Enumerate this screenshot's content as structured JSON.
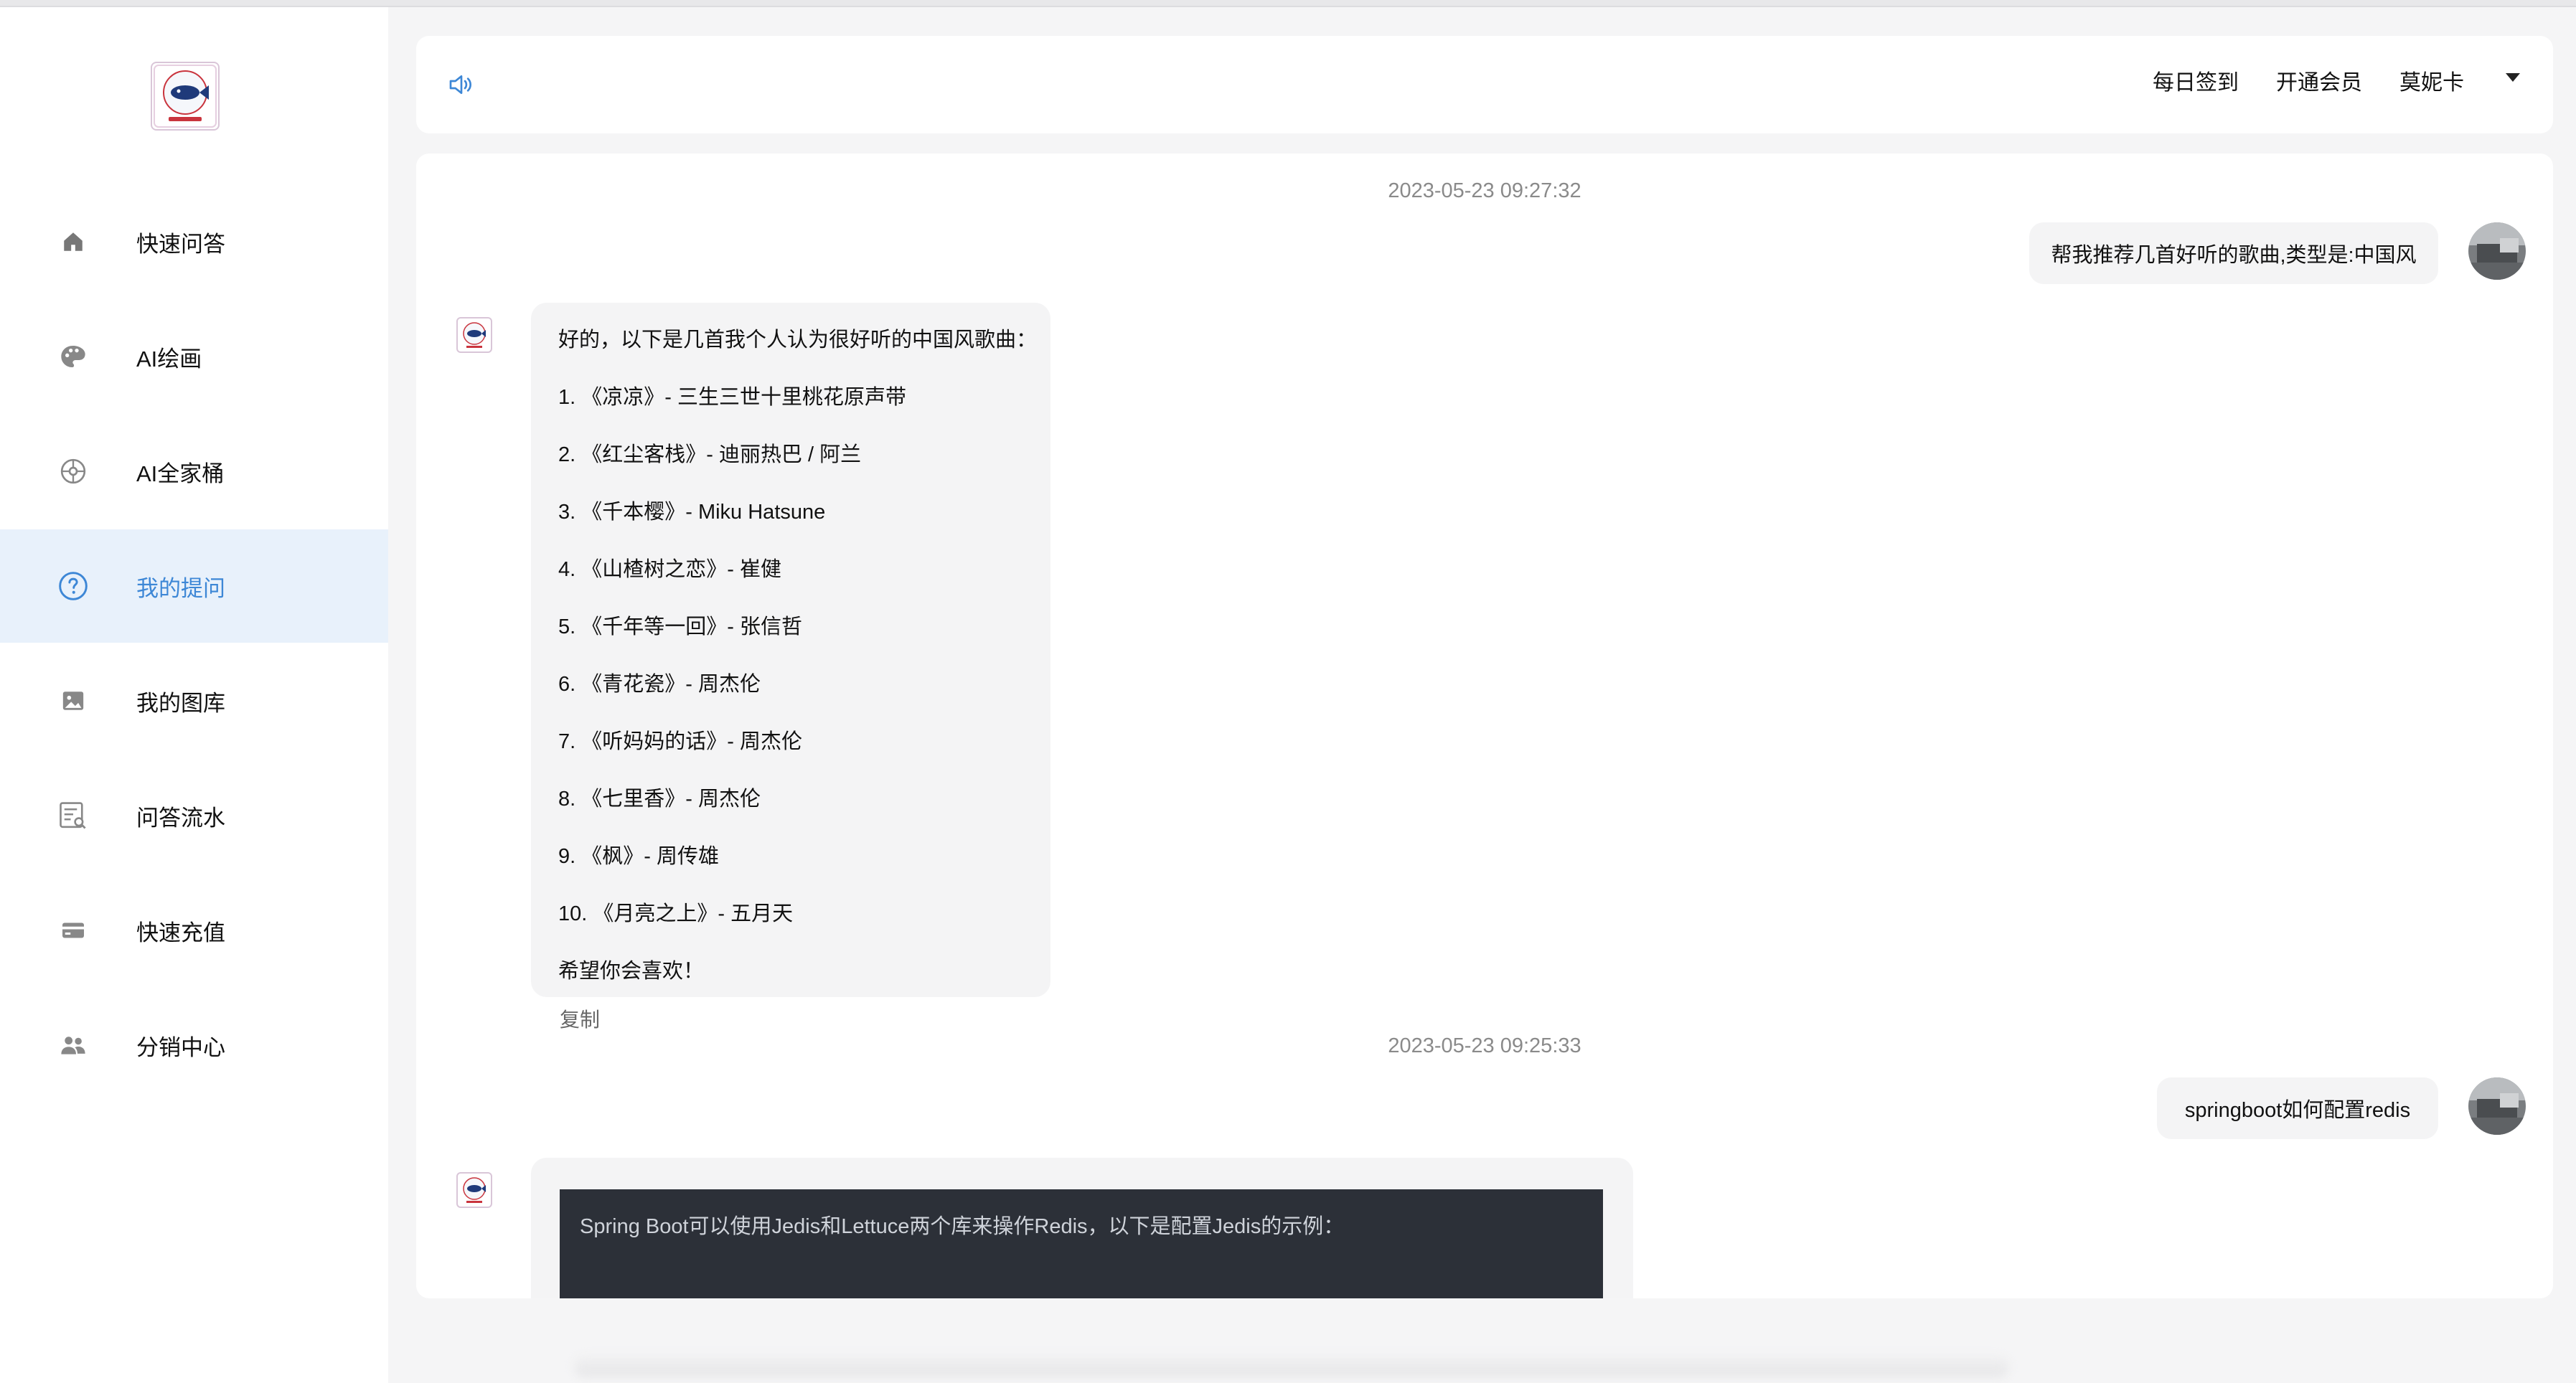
{
  "sidebar": {
    "items": [
      {
        "label": "快速问答",
        "icon": "home-icon",
        "active": false
      },
      {
        "label": "AI绘画",
        "icon": "palette-icon",
        "active": false
      },
      {
        "label": "AI全家桶",
        "icon": "apps-wheel-icon",
        "active": false
      },
      {
        "label": "我的提问",
        "icon": "question-circle-icon",
        "active": true
      },
      {
        "label": "我的图库",
        "icon": "image-gallery-icon",
        "active": false
      },
      {
        "label": "问答流水",
        "icon": "record-search-icon",
        "active": false
      },
      {
        "label": "快速充值",
        "icon": "card-icon",
        "active": false
      },
      {
        "label": "分销中心",
        "icon": "users-icon",
        "active": false
      }
    ]
  },
  "header": {
    "checkin": "每日签到",
    "membership": "开通会员",
    "username": "莫妮卡"
  },
  "chat": {
    "conversations": [
      {
        "timestamp": "2023-05-23 09:27:32",
        "question": "帮我推荐几首好听的歌曲,类型是:中国风",
        "answer_lines": [
          "好的，以下是几首我个人认为很好听的中国风歌曲：",
          "1. 《凉凉》- 三生三世十里桃花原声带",
          "2. 《红尘客栈》- 迪丽热巴 / 阿兰",
          "3. 《千本樱》- Miku Hatsune",
          "4. 《山楂树之恋》- 崔健",
          "5. 《千年等一回》- 张信哲",
          "6. 《青花瓷》- 周杰伦",
          "7. 《听妈妈的话》- 周杰伦",
          "8. 《七里香》- 周杰伦",
          "9. 《枫》- 周传雄",
          "10. 《月亮之上》- 五月天",
          "希望你会喜欢！"
        ],
        "copy_label": "复制"
      },
      {
        "timestamp": "2023-05-23 09:25:33",
        "question": "springboot如何配置redis",
        "answer_code_preview": "Spring Boot可以使用Jedis和Lettuce两个库来操作Redis，以下是配置Jedis的示例："
      }
    ]
  },
  "colors": {
    "accent": "#3d87d6",
    "active_bg": "#e8f1fb",
    "bubble_bg": "#f4f4f5",
    "code_bg": "#2c3038"
  }
}
